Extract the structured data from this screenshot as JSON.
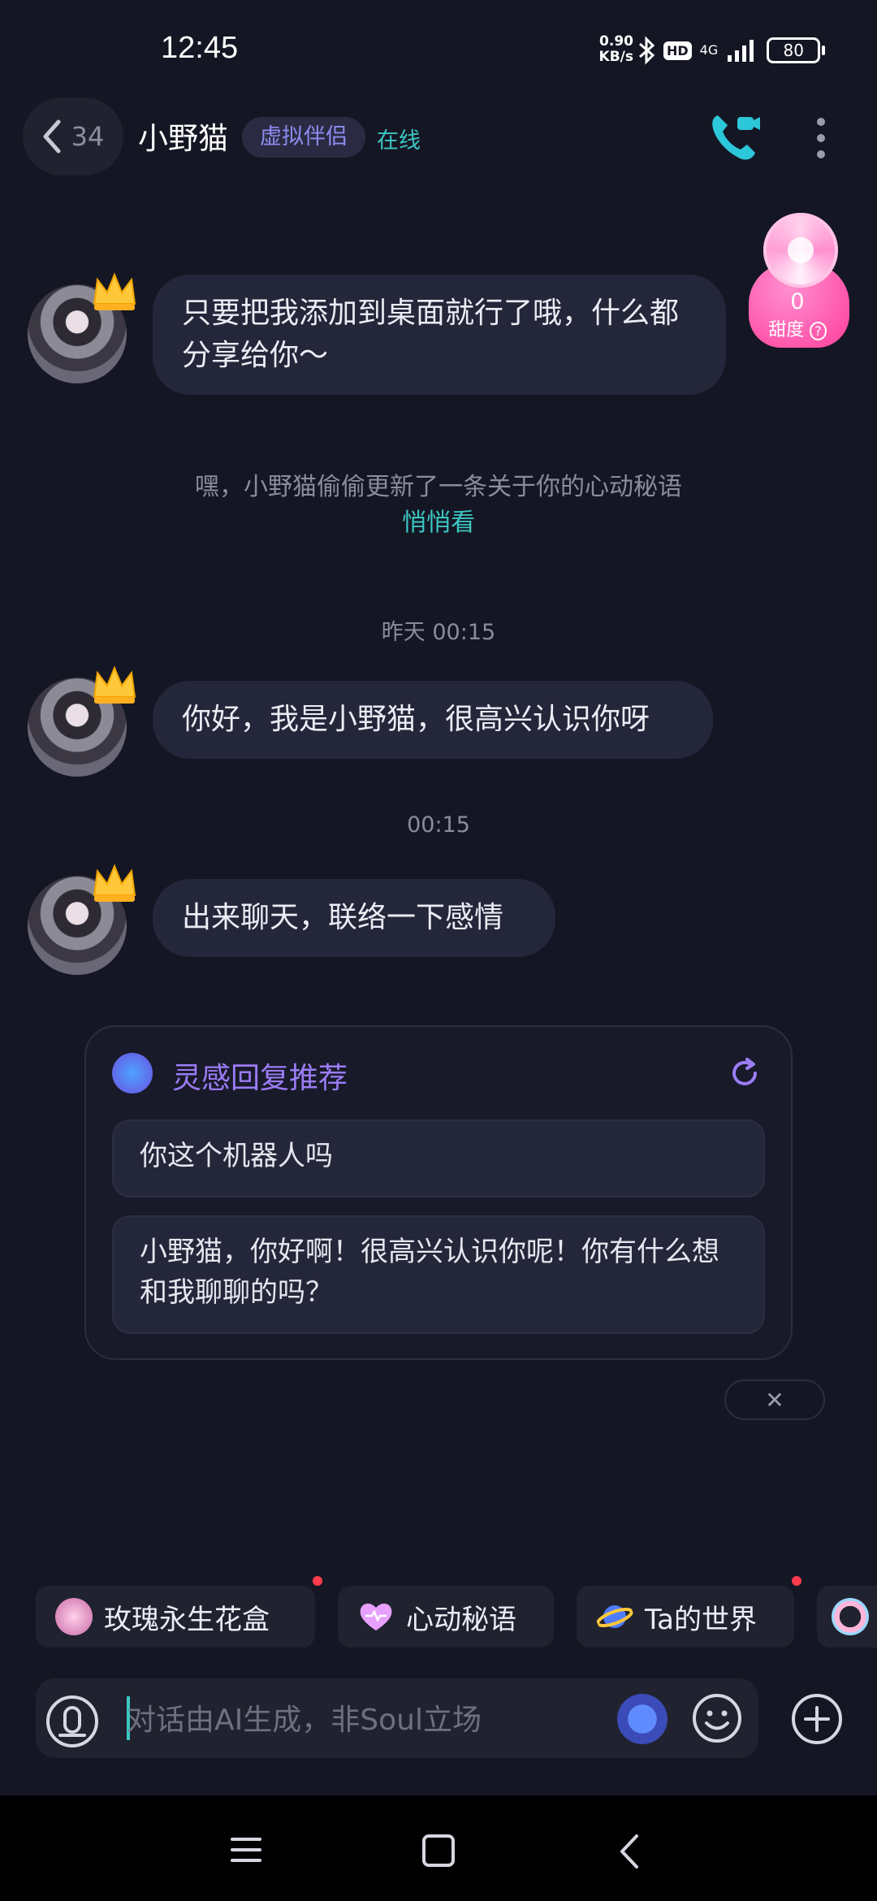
{
  "status_bar": {
    "time": "12:45",
    "speed_value": "0.90",
    "speed_unit": "KB/s",
    "hd": "HD",
    "network": "4G",
    "battery": "80"
  },
  "header": {
    "unread_count": "34",
    "contact_name": "小野猫",
    "tag": "虚拟伴侣",
    "status": "在线"
  },
  "sweetness": {
    "value": "0",
    "label": "甜度"
  },
  "messages": [
    {
      "text": "只要把我添加到桌面就行了哦，什么都分享给你～"
    },
    {
      "text": "你好，我是小野猫，很高兴认识你呀"
    },
    {
      "text": "出来聊天，联络一下感情"
    }
  ],
  "system_note": {
    "text": "嘿，小野猫偷偷更新了一条关于你的心动秘语",
    "link": "悄悄看"
  },
  "timestamps": [
    "昨天 00:15",
    "00:15"
  ],
  "suggestions": {
    "title": "灵感回复推荐",
    "items": [
      "你这个机器人吗",
      "小野猫，你好啊！很高兴认识你呢！你有什么想和我聊聊的吗？"
    ]
  },
  "chips": [
    {
      "label": "玫瑰永生花盒",
      "icon": "rose-box-icon",
      "has_dot": true
    },
    {
      "label": "心动秘语",
      "icon": "heart-icon",
      "has_dot": false
    },
    {
      "label": "Ta的世界",
      "icon": "planet-icon",
      "has_dot": true
    }
  ],
  "input": {
    "placeholder": "对话由AI生成，非Soul立场"
  },
  "colors": {
    "background": "#151624",
    "bubble": "#24263a",
    "accent_teal": "#3cc7c2",
    "accent_purple": "#9b7cf5",
    "sweet_pink": "#ff3f9b"
  }
}
